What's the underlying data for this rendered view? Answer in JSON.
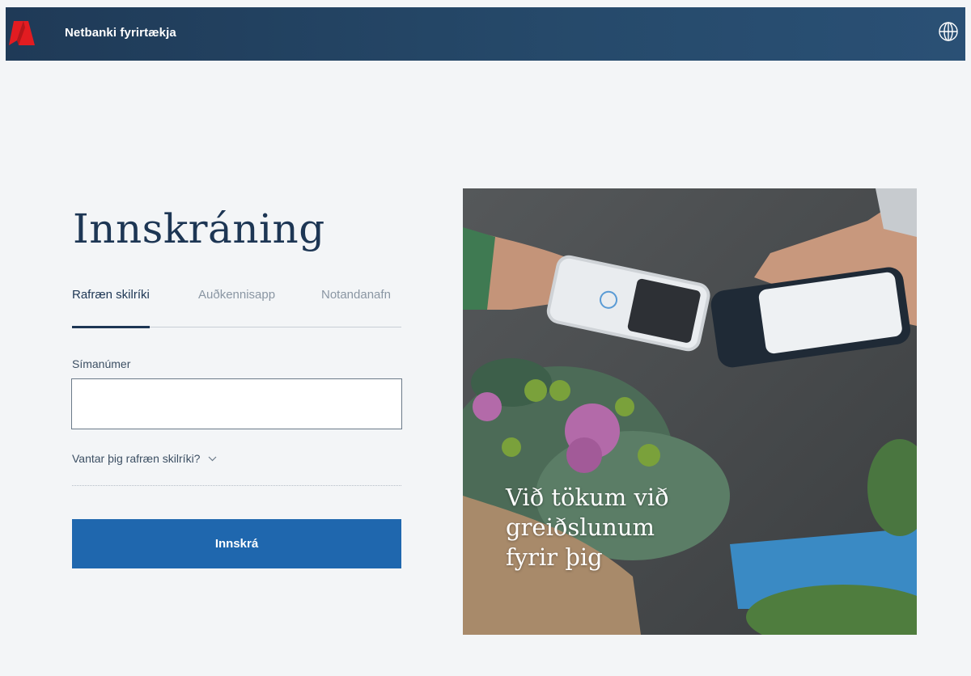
{
  "header": {
    "app_title": "Netbanki fyrirtækja",
    "logo_icon": "bank-logo-icon",
    "language_icon": "globe-icon",
    "brand_color": "#e21c21",
    "bar_color": "#1f3a57"
  },
  "login": {
    "heading": "Innskráning",
    "tabs": [
      {
        "label": "Rafræn skilríki",
        "active": true
      },
      {
        "label": "Auðkennisapp",
        "active": false
      },
      {
        "label": "Notandanafn",
        "active": false
      }
    ],
    "phone_label": "Símanúmer",
    "phone_value": "",
    "help_toggle_label": "Vantar þig rafræn skilríki?",
    "help_toggle_icon": "chevron-down-icon",
    "submit_label": "Innskrá",
    "button_color": "#1f67ae"
  },
  "promo": {
    "text_line1": "Við tökum við",
    "text_line2": "greiðslunum",
    "text_line3": "fyrir þig"
  }
}
